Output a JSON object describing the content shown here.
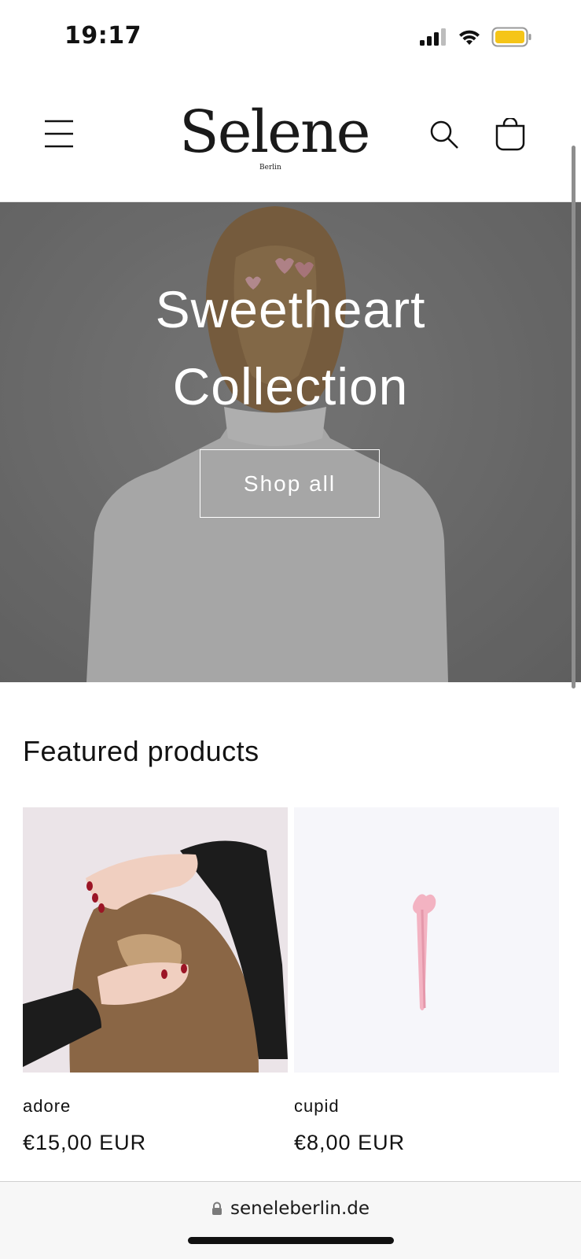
{
  "status_bar": {
    "time": "19:17",
    "icons": [
      "cellular-signal-icon",
      "wifi-icon",
      "battery-icon"
    ],
    "battery_color": "#F5C518"
  },
  "header": {
    "logo_text": "Selene",
    "logo_subtext": "Berlin",
    "icons": [
      "menu-icon",
      "search-icon",
      "cart-icon"
    ]
  },
  "hero": {
    "title_line1": "Sweetheart",
    "title_line2": "Collection",
    "button_label": "Shop all"
  },
  "featured": {
    "title": "Featured products",
    "products": [
      {
        "name": "adore",
        "price": "€15,00 EUR"
      },
      {
        "name": "cupid",
        "price": "€8,00 EUR"
      }
    ]
  },
  "browser": {
    "url": "seneleberlin.de"
  },
  "colors": {
    "text": "#121212",
    "hero_overlay": "#7b7b7b",
    "background": "#ffffff"
  }
}
